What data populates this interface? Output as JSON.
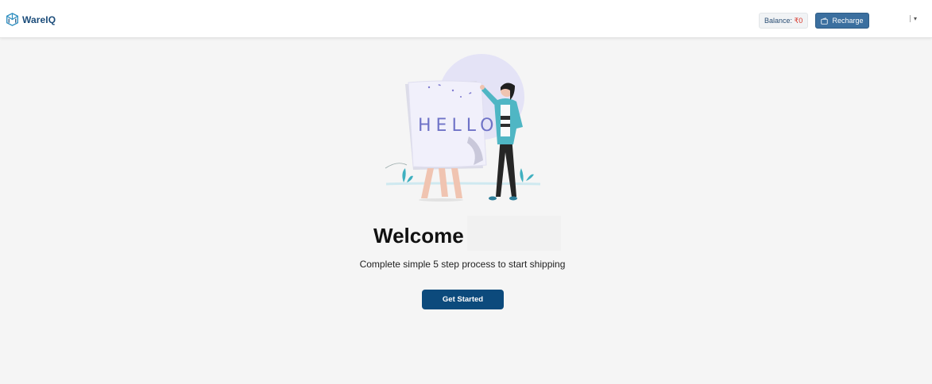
{
  "header": {
    "brand": "WareIQ",
    "balance_label": "Balance: ",
    "balance_amount": "₹0",
    "recharge_label": "Recharge",
    "user_menu_caret": "▾"
  },
  "illustration": {
    "sign_text": "HELLO"
  },
  "main": {
    "title": "Welcome",
    "subtitle": "Complete simple 5 step process to start shipping",
    "cta_label": "Get Started"
  },
  "colors": {
    "brand": "#1b4c7a",
    "primary_button": "#0c4a7c",
    "recharge_button": "#3b6f9f",
    "balance_amount": "#d8362a",
    "accent_teal": "#3fb0c0",
    "background": "#f5f5f5"
  }
}
